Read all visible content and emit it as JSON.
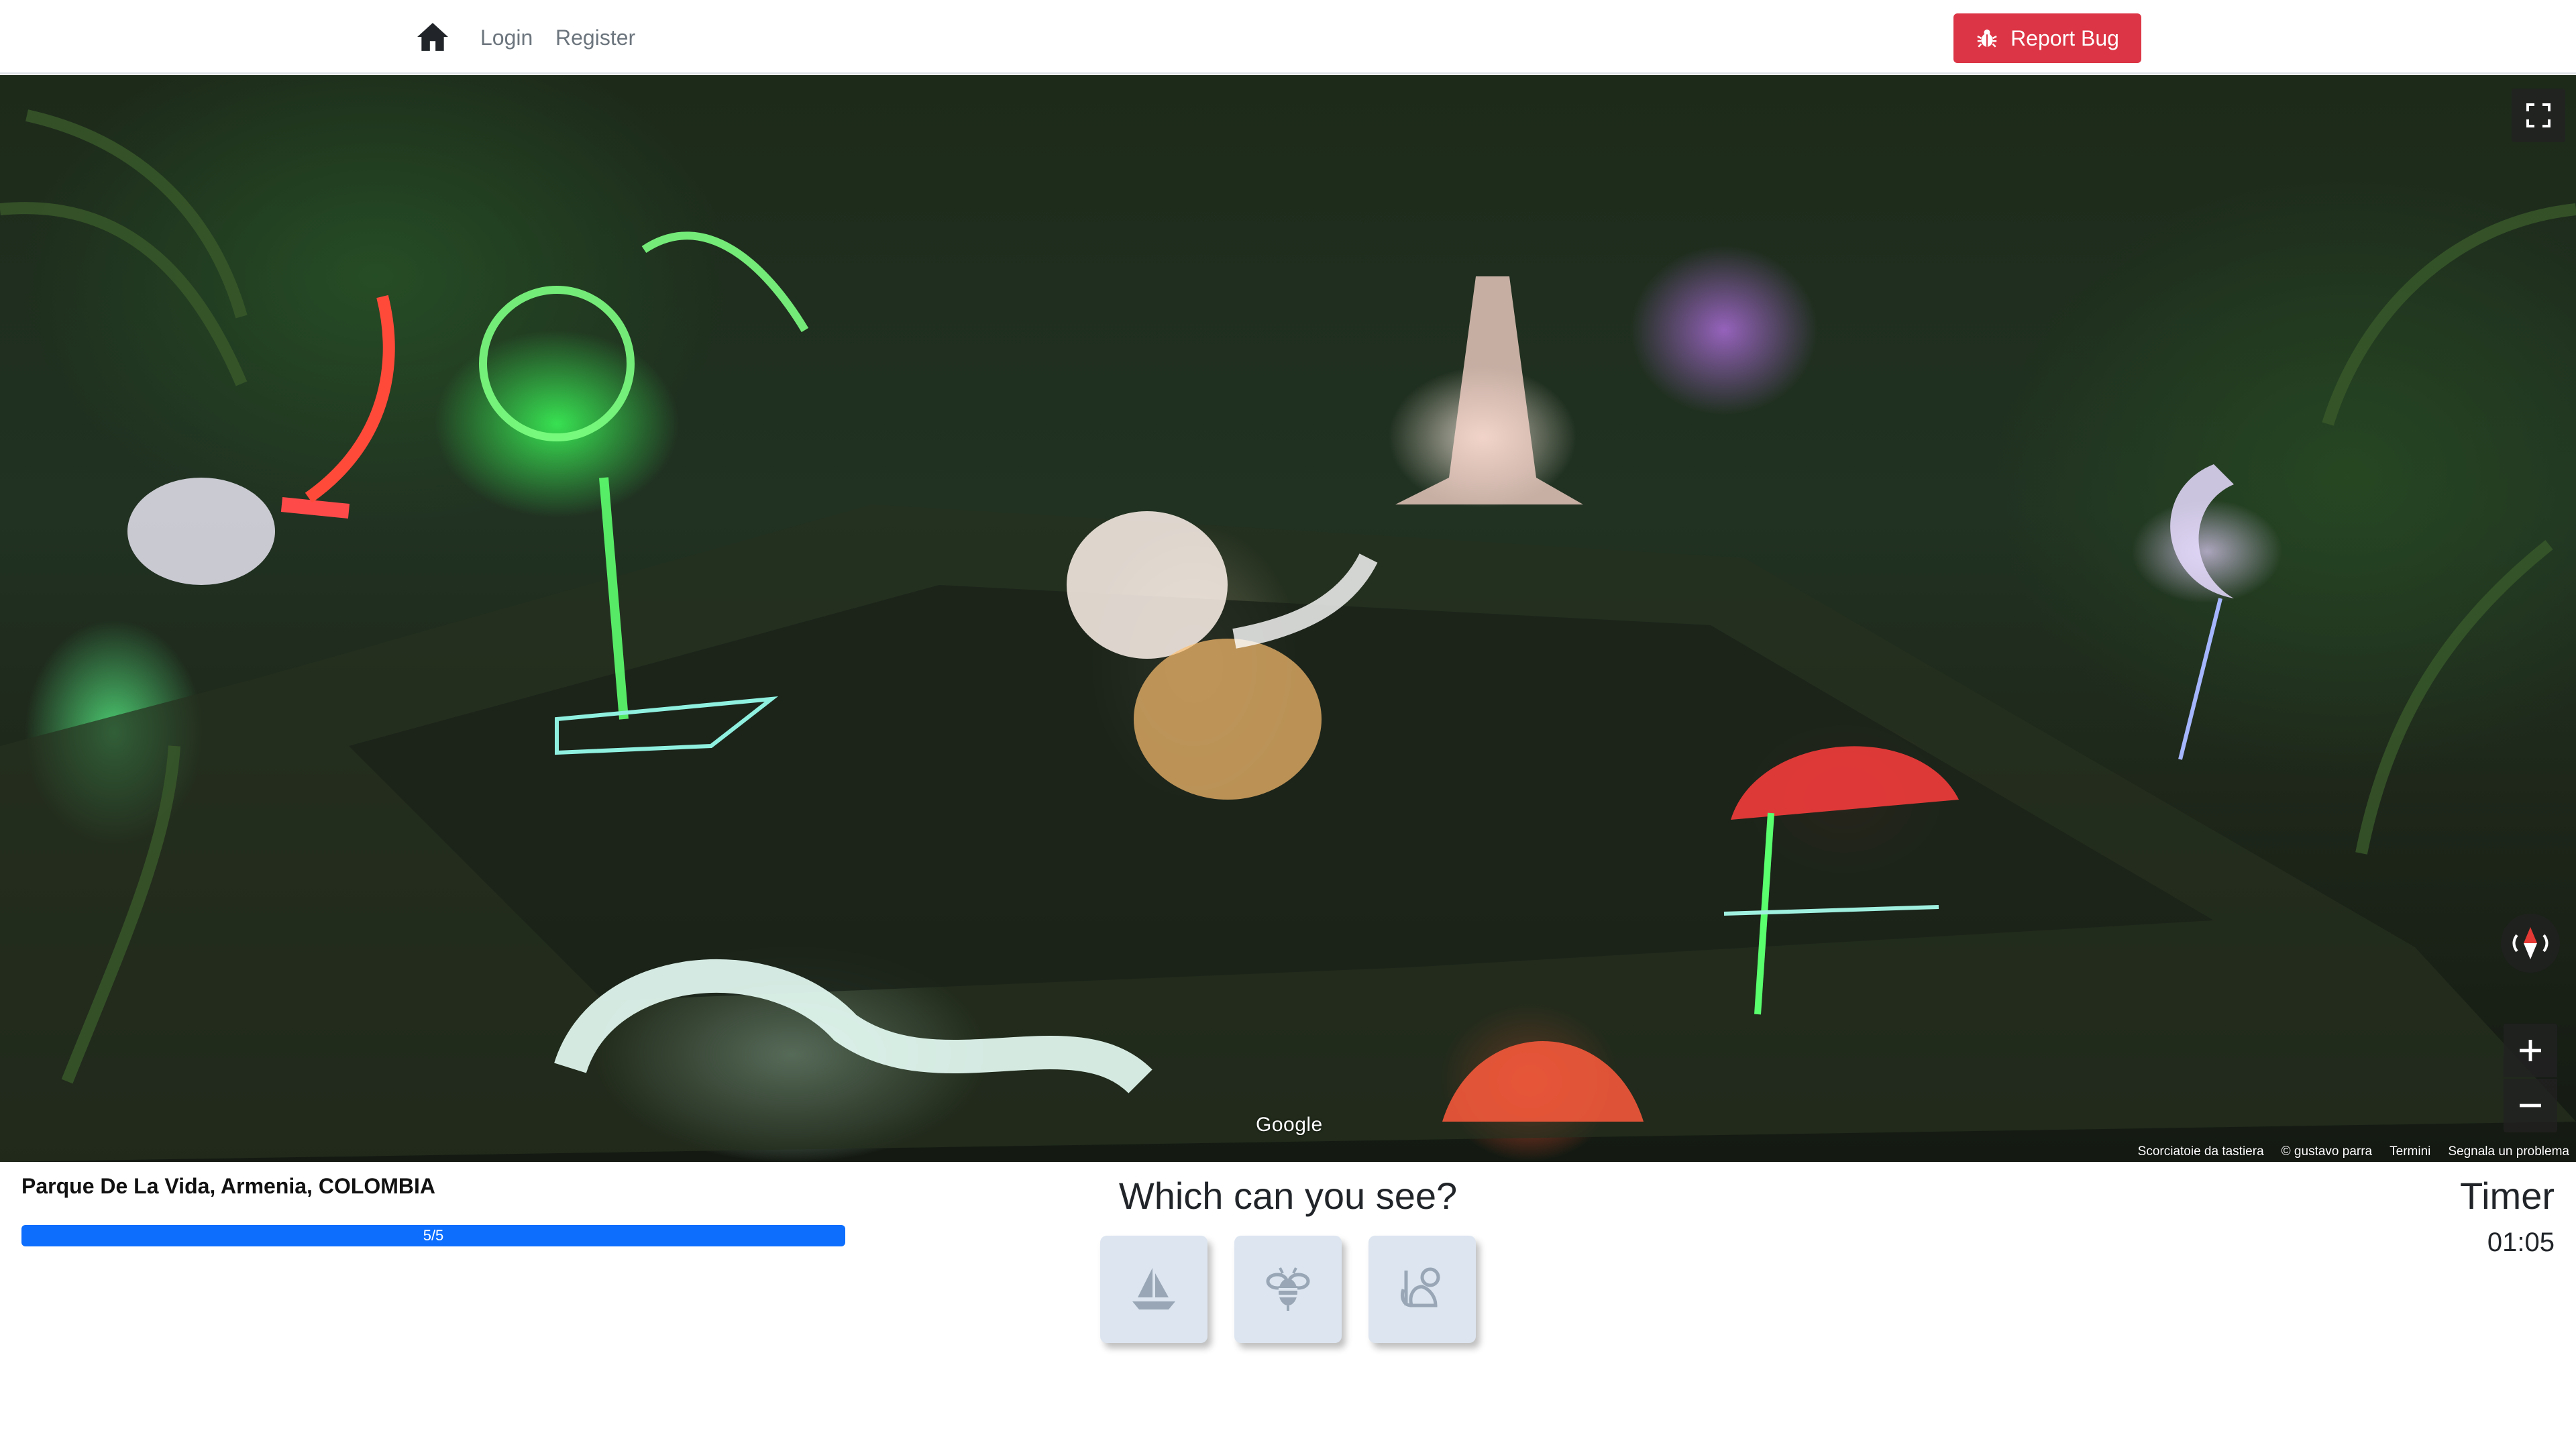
{
  "navbar": {
    "home_icon": "home-icon",
    "login_label": "Login",
    "register_label": "Register",
    "report_bug_label": "Report Bug",
    "report_bug_icon": "bug-icon",
    "report_bug_color": "#dc3545"
  },
  "viewer": {
    "google_label": "Google",
    "attribution": {
      "shortcuts": "Scorciatoie da tastiera",
      "author": "© gustavo parra",
      "terms": "Termini",
      "report": "Segnala un problema"
    },
    "fullscreen_icon": "fullscreen-icon",
    "compass_icon": "compass-icon",
    "zoom_in_label": "+",
    "zoom_out_label": "−"
  },
  "game": {
    "location": "Parque De La Vida, Armenia, COLOMBIA",
    "progress_label": "5/5",
    "progress_value": 1.0,
    "progress_color": "#0d6efd",
    "question": "Which can you see?",
    "choices": [
      {
        "icon": "sailboat-icon"
      },
      {
        "icon": "bee-icon"
      },
      {
        "icon": "monkey-icon"
      }
    ],
    "timer_label": "Timer",
    "timer_value": "01:05"
  }
}
